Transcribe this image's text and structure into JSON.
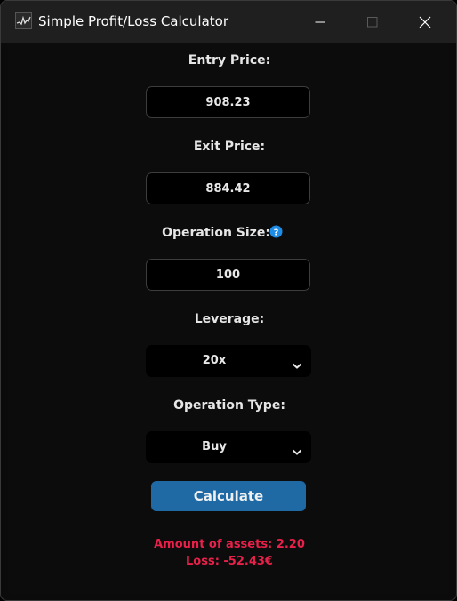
{
  "window": {
    "title": "Simple Profit/Loss Calculator"
  },
  "form": {
    "entry_price_label": "Entry Price:",
    "entry_price_value": "908.23",
    "exit_price_label": "Exit Price:",
    "exit_price_value": "884.42",
    "operation_size_label": "Operation Size:",
    "operation_size_value": "100",
    "leverage_label": "Leverage:",
    "leverage_value": "20x",
    "operation_type_label": "Operation Type:",
    "operation_type_value": "Buy",
    "calculate_label": "Calculate"
  },
  "result": {
    "amount_text": "Amount of assets: 2.20",
    "loss_text": "Loss: -52.43€",
    "color": "#e8204a"
  },
  "colors": {
    "accent": "#1f6aa5",
    "help": "#1f8ce6"
  },
  "icons": {
    "app": "chart-line-icon",
    "help": "question-circle-icon",
    "dropdown": "chevron-down-icon"
  }
}
